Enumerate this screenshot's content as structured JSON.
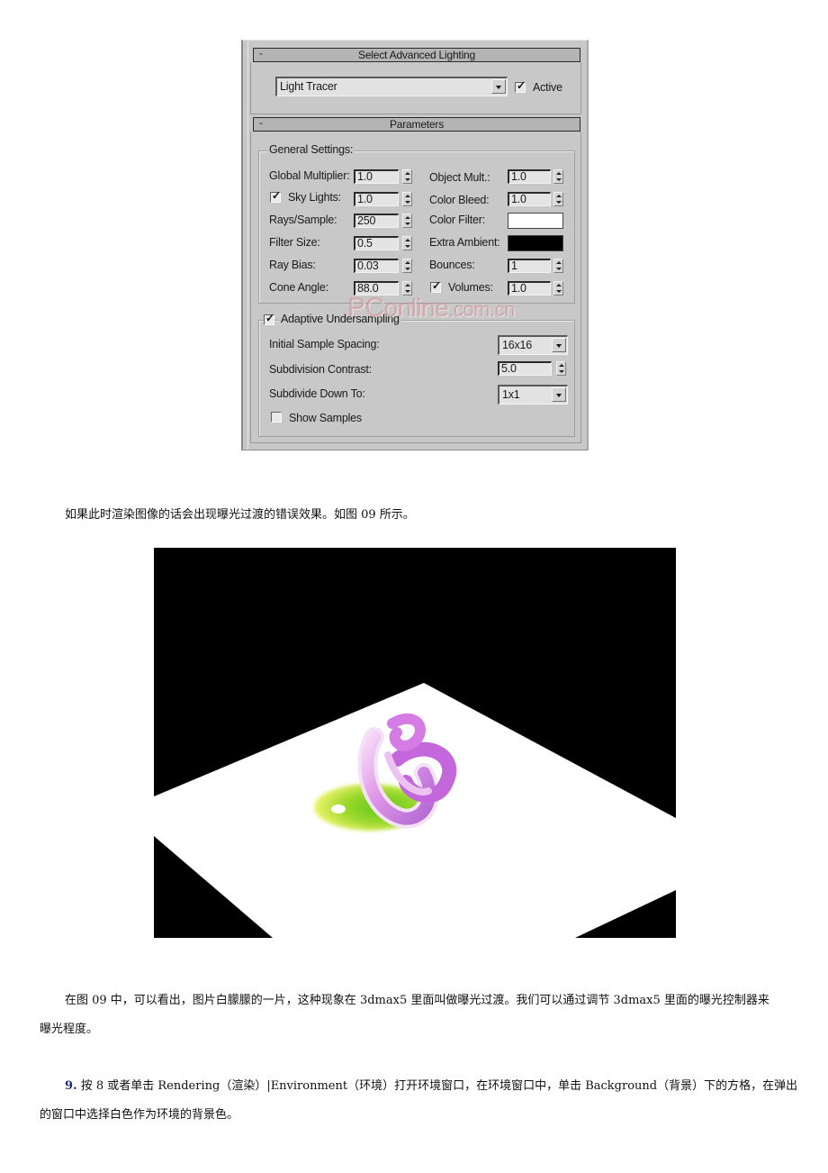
{
  "panel": {
    "advanced_lighting": {
      "rollout_toggle": "-",
      "title": "Select Advanced Lighting",
      "plugin_dropdown": {
        "value": "Light Tracer"
      },
      "active": {
        "label": "Active",
        "checked": true
      }
    },
    "parameters": {
      "rollout_toggle": "-",
      "title": "Parameters",
      "general_settings_label": "General Settings:",
      "left_column": [
        {
          "label": "Global Multiplier:",
          "value": "1.0",
          "has_checkbox": false
        },
        {
          "label": "Sky Lights:",
          "value": "1.0",
          "has_checkbox": true,
          "checked": true
        },
        {
          "label": "Rays/Sample:",
          "value": "250",
          "has_checkbox": false
        },
        {
          "label": "Filter Size:",
          "value": "0.5",
          "has_checkbox": false
        },
        {
          "label": "Ray Bias:",
          "value": "0.03",
          "has_checkbox": false
        },
        {
          "label": "Cone Angle:",
          "value": "88.0",
          "has_checkbox": false
        }
      ],
      "right_column": [
        {
          "label": "Object Mult.:",
          "value": "1.0"
        },
        {
          "label": "Color Bleed:",
          "value": "1.0"
        },
        {
          "label": "Color Filter:",
          "color": "#ffffff"
        },
        {
          "label": "Extra Ambient:",
          "color": "#000000"
        },
        {
          "label": "Bounces:",
          "value": "1"
        },
        {
          "label": "Volumes:",
          "value": "1.0",
          "checked": true
        }
      ],
      "adaptive": {
        "label": "Adaptive Undersampling",
        "checked": true,
        "initial_sample_spacing": {
          "label": "Initial Sample Spacing:",
          "value": "16x16"
        },
        "subdivision_contrast": {
          "label": "Subdivision Contrast:",
          "value": "5.0"
        },
        "subdivide_down_to": {
          "label": "Subdivide Down To:",
          "value": "1x1"
        },
        "show_samples": {
          "label": "Show Samples",
          "checked": false
        }
      }
    },
    "watermark": {
      "part1": "PC",
      "part2": "online",
      "part3": ".com.cn"
    }
  },
  "document": {
    "para1": "如果此时渲染图像的话会出现曝光过渡的错误效果。如图 09 所示。",
    "para2_line1": "在图 09 中，可以看出，图片白朦朦的一片，这种现象在 3dmax5 里面叫做曝光过渡。我们可以通过调节 3dmax5 里面的曝光控制器来",
    "para2_line2": "曝光程度。",
    "para3_number": "9.",
    "para3_line1": " 按 8 或者单击 Rendering（渲染）|Environment（环境）打开环境窗口，在环境窗口中，单击 Background（背景）下的方格，在弹出",
    "para3_line2": "的窗口中选择白色作为环境的背景色。"
  },
  "render_image": {
    "description": "rendered knot object over white plane with black background (overexposed)",
    "colors": {
      "background": "#000000",
      "plane": "#ffffff",
      "object": "#d873e0",
      "shadow_green": "#8fdc2a",
      "shadow_yellow": "#e6f25a"
    }
  }
}
